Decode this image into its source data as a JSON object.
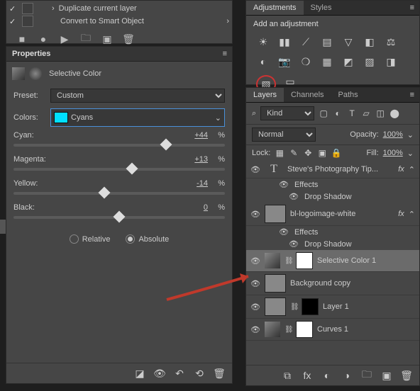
{
  "top_actions": {
    "dup": "Duplicate current layer",
    "smart": "Convert to Smart Object"
  },
  "properties": {
    "title": "Properties",
    "label": "Selective Color",
    "preset_lbl": "Preset:",
    "preset_val": "Custom",
    "colors_lbl": "Colors:",
    "colors_val": "Cyans",
    "sliders": [
      {
        "name": "Cyan:",
        "value": "+44",
        "pos": 72
      },
      {
        "name": "Magenta:",
        "value": "+13",
        "pos": 56
      },
      {
        "name": "Yellow:",
        "value": "-14",
        "pos": 43
      },
      {
        "name": "Black:",
        "value": "0",
        "pos": 50
      }
    ],
    "pct": "%",
    "relative": "Relative",
    "absolute": "Absolute"
  },
  "adjustments": {
    "tab1": "Adjustments",
    "tab2": "Styles",
    "add": "Add an adjustment"
  },
  "layers_panel": {
    "tab1": "Layers",
    "tab2": "Channels",
    "tab3": "Paths",
    "kind": "Kind",
    "normal": "Normal",
    "opacity_lbl": "Opacity:",
    "opacity": "100%",
    "lock": "Lock:",
    "fill_lbl": "Fill:",
    "fill": "100%",
    "layers": [
      {
        "name": "Steve's Photography Tip...",
        "type": "text",
        "fx": true,
        "effects": true,
        "shadow": "Drop Shadow"
      },
      {
        "name": "bl-logoimage-white",
        "type": "img",
        "fx": true,
        "effects": true,
        "shadow": "Drop Shadow"
      },
      {
        "name": "Selective Color 1",
        "type": "adj",
        "selected": true
      },
      {
        "name": "Background copy",
        "type": "img"
      },
      {
        "name": "Layer 1",
        "type": "img",
        "mask": "blk"
      },
      {
        "name": "Curves 1",
        "type": "adj"
      }
    ],
    "effects_lbl": "Effects",
    "fx_lbl": "fx"
  },
  "chart_data": {
    "type": "bar",
    "categories": [
      "Cyan",
      "Magenta",
      "Yellow",
      "Black"
    ],
    "values": [
      44,
      13,
      -14,
      0
    ],
    "title": "Selective Color — Cyans",
    "xlabel": "",
    "ylabel": "%",
    "ylim": [
      -100,
      100
    ]
  }
}
